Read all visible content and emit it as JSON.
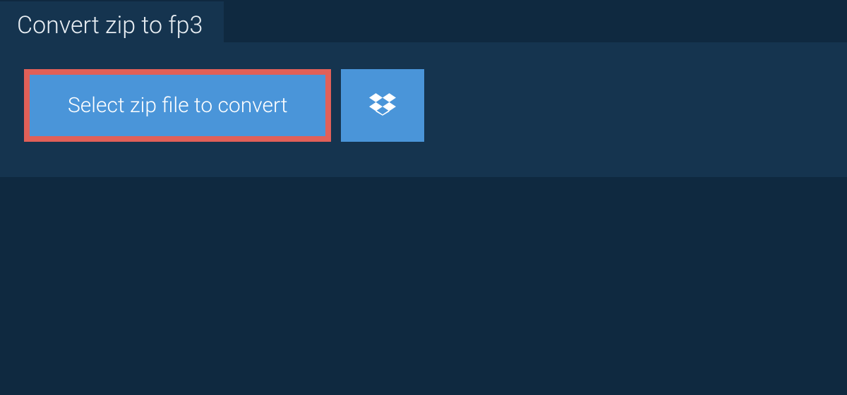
{
  "tab": {
    "title": "Convert zip to fp3"
  },
  "actions": {
    "select_label": "Select zip file to convert"
  },
  "colors": {
    "background": "#0f2940",
    "panel": "#15344f",
    "button": "#4a95d9",
    "highlight_border": "#e16058",
    "text_light": "#ffffff"
  }
}
